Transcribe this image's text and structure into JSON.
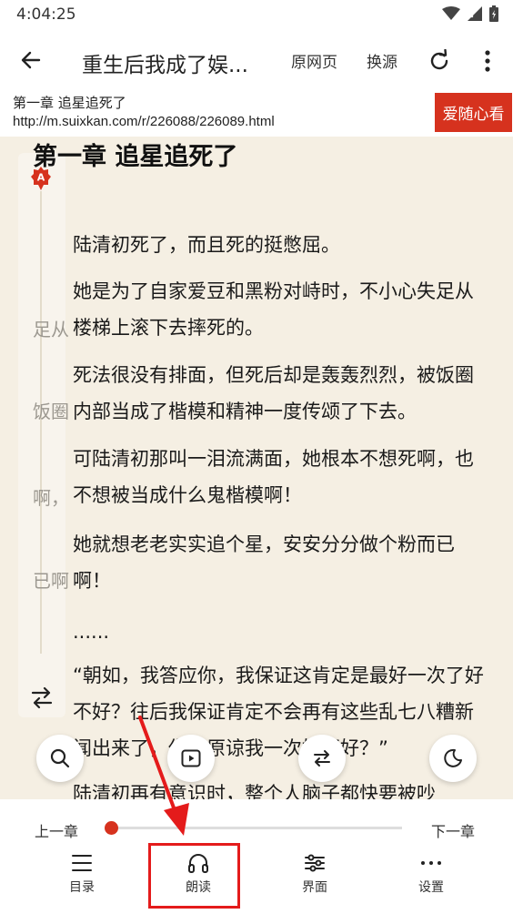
{
  "status": {
    "time": "4:04:25"
  },
  "toolbar": {
    "book_title": "重生后我成了娱...",
    "original_page": "原网页",
    "change_source": "换源"
  },
  "info": {
    "chapter_name": "第一章 追星追死了",
    "url": "http://m.suixkan.com/r/226088/226089.html",
    "fav_label": "爱随心看"
  },
  "reader": {
    "title": "第一章 追星追死了",
    "ad_badge": "A",
    "overlap": [
      "足从",
      "饭圈",
      "啊，",
      "已啊"
    ],
    "paragraphs": [
      "陆清初死了，而且死的挺憋屈。",
      "她是为了自家爱豆和黑粉对峙时，不小心失足从楼梯上滚下去摔死的。",
      "死法很没有排面，但死后却是轰轰烈烈，被饭圈内部当成了楷模和精神一度传颂了下去。",
      "可陆清初那叫一泪流满面，她根本不想死啊，也不想被当成什么鬼楷模啊！",
      "她就想老老实实追个星，安安分分做个粉而已啊！",
      "......",
      "“朝如，我答应你，我保证这肯定是最好一次了好不好？往后我保证肯定不会再有这些乱七八糟新闻出来了，你再原谅我一次好不好？”",
      "陆清初再有意识时，整个人脑子都快要被吵"
    ]
  },
  "bottom": {
    "prev_chapter": "上一章",
    "next_chapter": "下一章",
    "progress": 0.0,
    "nav": [
      {
        "label": "目录"
      },
      {
        "label": "朗读"
      },
      {
        "label": "界面"
      },
      {
        "label": "设置"
      }
    ]
  },
  "colors": {
    "accent": "#d6321e",
    "paper": "#f5efe3",
    "highlight": "#e41b1b"
  }
}
